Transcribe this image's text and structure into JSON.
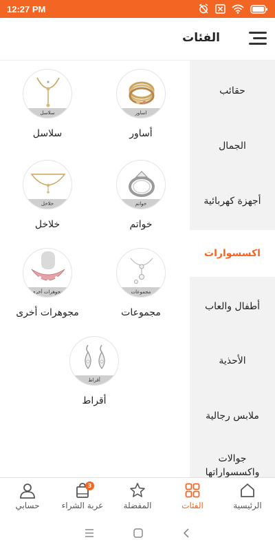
{
  "status_bar": {
    "time": "12:27 PM",
    "background": "#f26522",
    "icons": [
      "alarm-off-icon",
      "close-box-icon",
      "wifi-icon",
      "battery-icon"
    ]
  },
  "header": {
    "title": "الفئات",
    "menu_icon": "hamburger-menu-icon"
  },
  "sidebar": {
    "items": [
      {
        "label": "حقائب",
        "active": false
      },
      {
        "label": "الجمال",
        "active": false
      },
      {
        "label": "أجهزة كهربائية",
        "active": false
      },
      {
        "label": "اكسسوارات",
        "active": true
      },
      {
        "label": "أطفال والعاب",
        "active": false
      },
      {
        "label": "الأحذية",
        "active": false
      },
      {
        "label": "ملابس رجالية",
        "active": false
      },
      {
        "label": "جوالات واكسسواراتها",
        "active": false
      }
    ]
  },
  "products": [
    {
      "name": "أساور",
      "tag": "اساور",
      "icon": "bracelet-icon"
    },
    {
      "name": "سلاسل",
      "tag": "سلاسل",
      "icon": "necklace-icon"
    },
    {
      "name": "خواتم",
      "tag": "خواتم",
      "icon": "ring-icon"
    },
    {
      "name": "خلاخل",
      "tag": "خلاخل",
      "icon": "anklet-icon"
    },
    {
      "name": "مجموعات",
      "tag": "مجموعات",
      "icon": "jewelry-set-icon"
    },
    {
      "name": "مجوهرات أخرى",
      "tag": "مجوهرات أخرى",
      "icon": "gem-necklace-icon"
    },
    {
      "name": "أقراط",
      "tag": "أقراط",
      "icon": "earrings-icon"
    }
  ],
  "bottom_nav": {
    "items": [
      {
        "label": "الرئيسية",
        "icon": "home-icon",
        "active": false
      },
      {
        "label": "الفئات",
        "icon": "categories-grid-icon",
        "active": true
      },
      {
        "label": "المفضلة",
        "icon": "star-icon",
        "active": false
      },
      {
        "label": "عربة الشراء",
        "icon": "cart-icon",
        "active": false,
        "badge": "3"
      },
      {
        "label": "حسابي",
        "icon": "user-icon",
        "active": false
      }
    ]
  },
  "colors": {
    "accent": "#f26522",
    "sidebar_bg": "#f2f2f2",
    "text": "#222222"
  }
}
